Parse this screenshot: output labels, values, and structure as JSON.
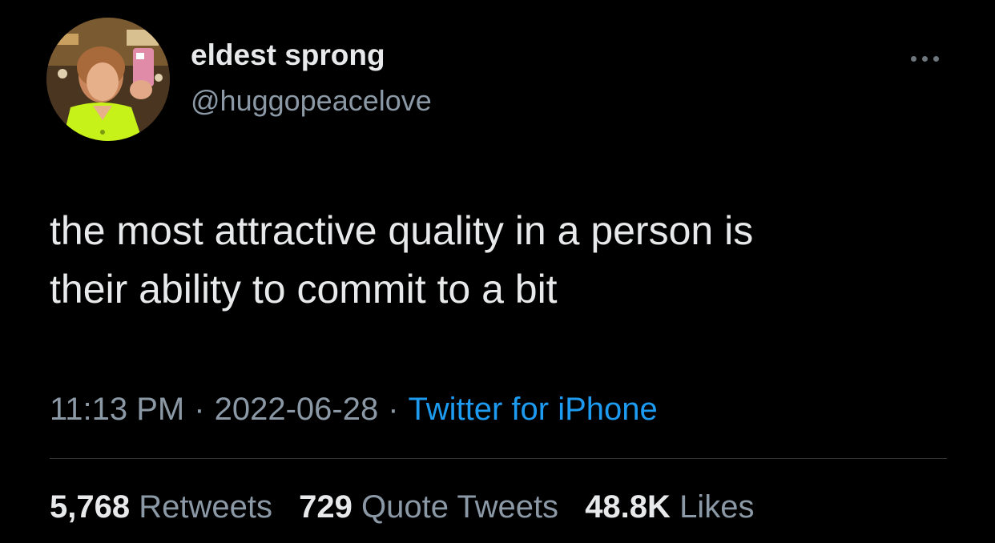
{
  "author": {
    "display_name": "eldest sprong",
    "handle": "@huggopeacelove"
  },
  "tweet": {
    "text_line1": "the most attractive quality in a person is",
    "text_line2": "their ability to commit to a bit"
  },
  "meta": {
    "time": "11:13 PM",
    "separator": "·",
    "date": "2022-06-28",
    "source": "Twitter for iPhone"
  },
  "stats": {
    "retweets_count": "5,768",
    "retweets_label": "Retweets",
    "quotes_count": "729",
    "quotes_label": "Quote Tweets",
    "likes_count": "48.8K",
    "likes_label": "Likes"
  },
  "icons": {
    "more": "more-horizontal-icon"
  },
  "colors": {
    "background": "#000000",
    "primary_text": "#e7e9ea",
    "secondary_text": "#8b98a5",
    "link": "#1d9bf0",
    "divider": "#2f3336"
  }
}
